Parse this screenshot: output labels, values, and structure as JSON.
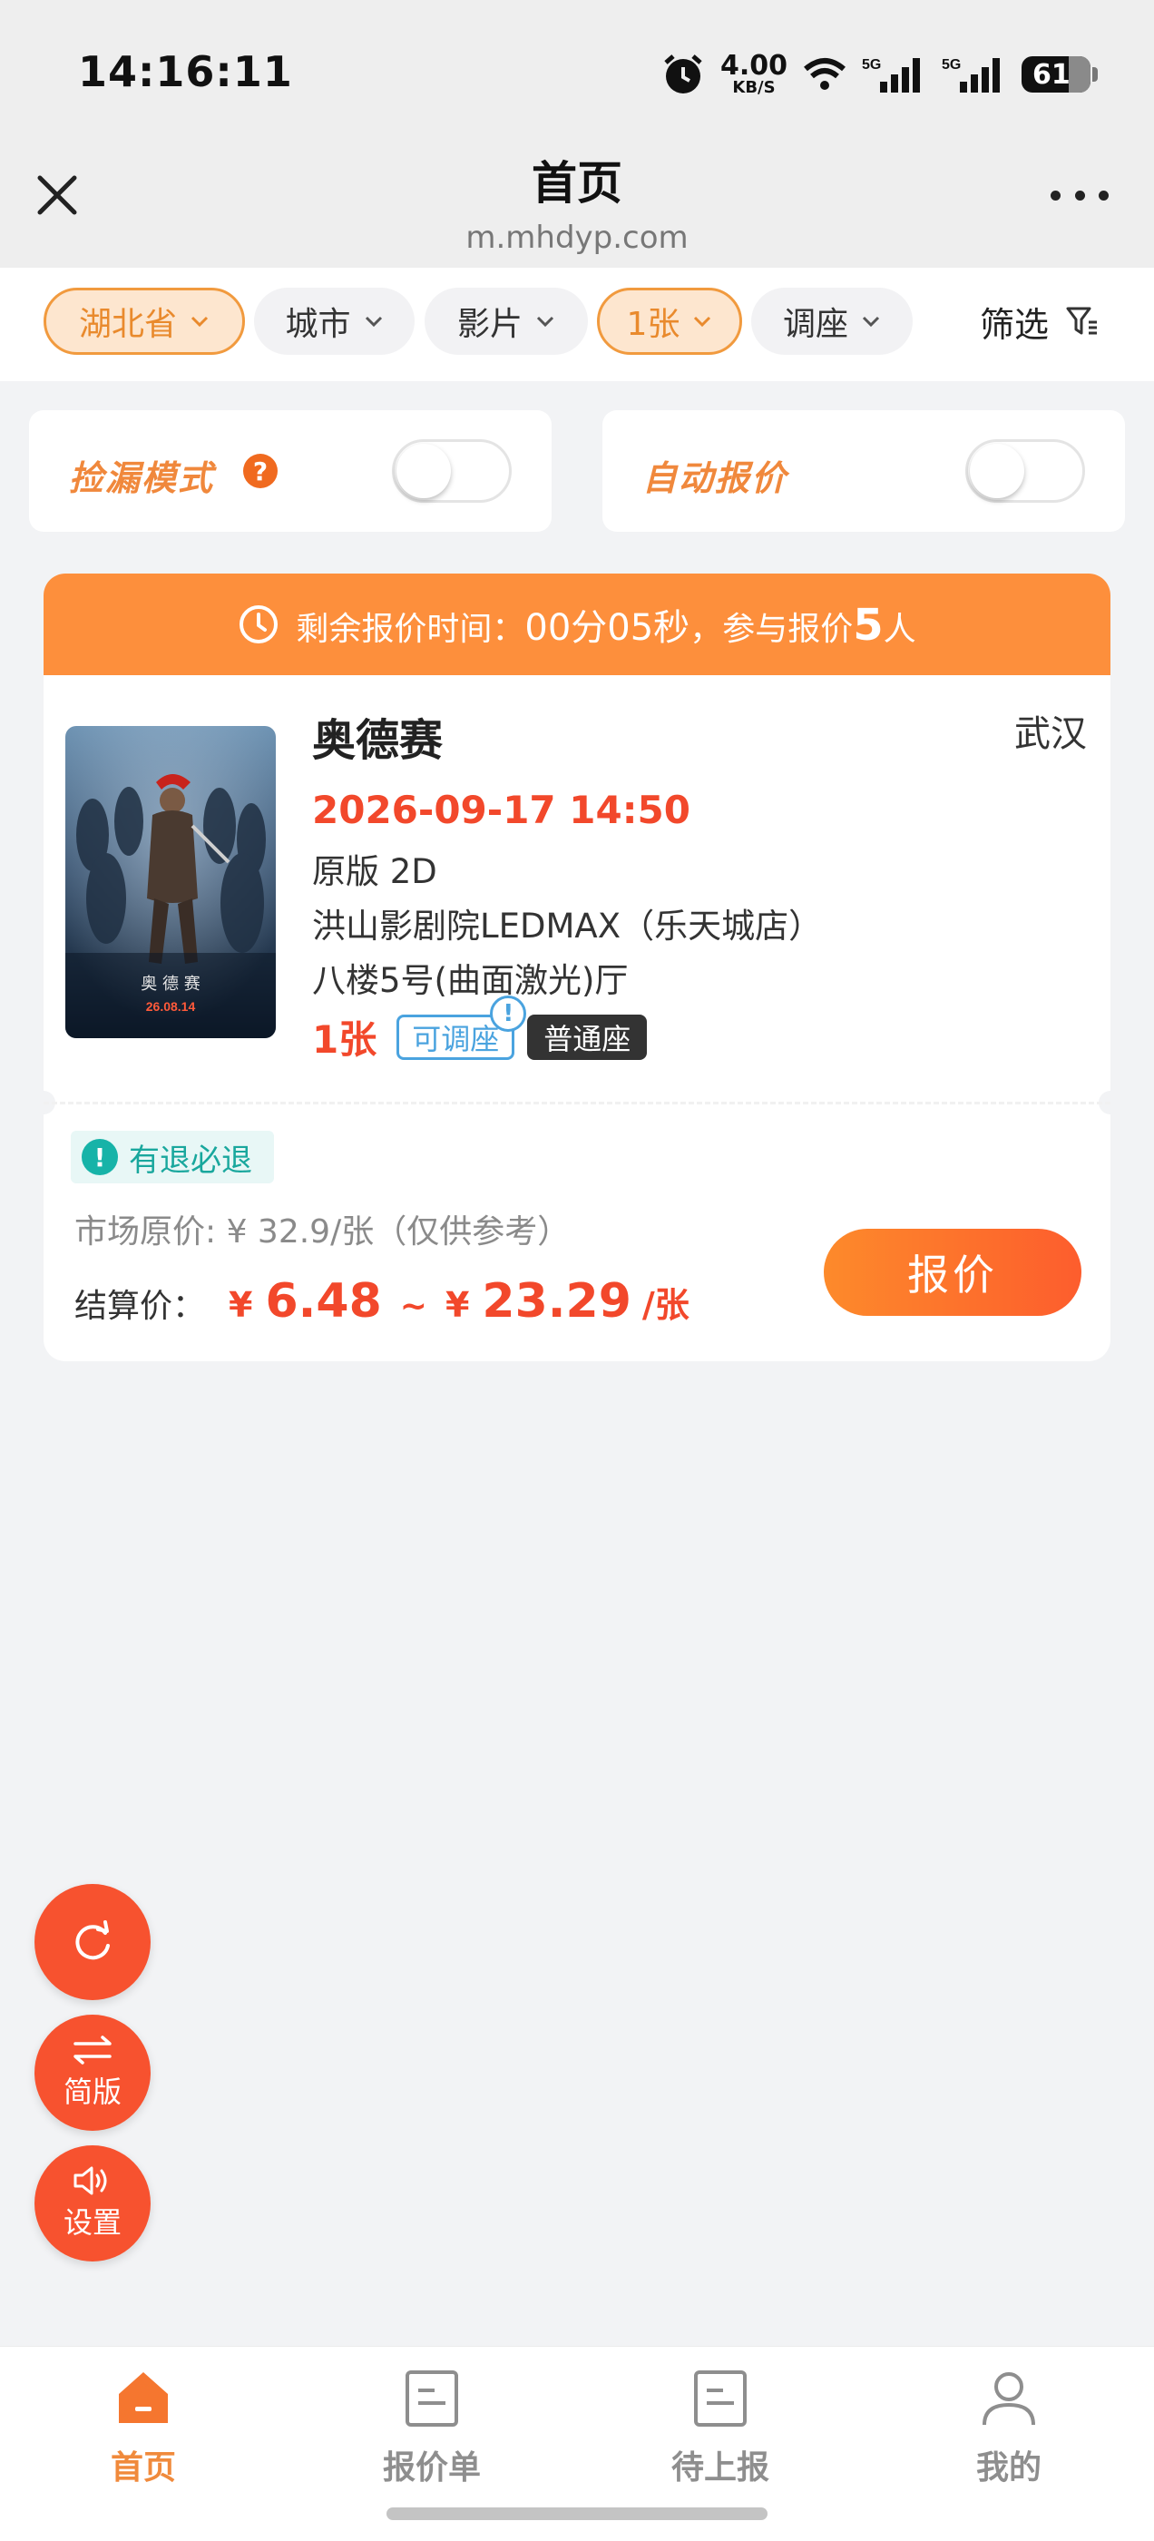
{
  "status_bar": {
    "time": "14:16:11",
    "net_speed_value": "4.00",
    "net_speed_unit": "KB/S",
    "signal_1": "5G",
    "signal_2": "5G",
    "battery": "61"
  },
  "header": {
    "title": "首页",
    "url": "m.mhdyp.com"
  },
  "filters": {
    "province": "湖北省",
    "city": "城市",
    "movie": "影片",
    "tickets": "1张",
    "seat_adjust": "调座",
    "filter_label": "筛选"
  },
  "toggles": {
    "pickup_mode": {
      "label": "捡漏模式",
      "help": "?",
      "on": false
    },
    "auto_quote": {
      "label": "自动报价",
      "on": false
    }
  },
  "order": {
    "countdown_label": "剩余报价时间：",
    "countdown": "00分05秒",
    "participants_prefix": "，参与报价",
    "participants_count": "5",
    "participants_suffix": "人",
    "movie_title": "奥德赛",
    "city": "武汉",
    "show_time": "2026-09-17 14:50",
    "version": "原版 2D",
    "cinema": "洪山影剧院LEDMAX（乐天城店）",
    "hall": "八楼5号(曲面激光)厅",
    "quantity": "1张",
    "tag_adjustable": "可调座",
    "tag_seat_type": "普通座",
    "refund_label": "有退必退",
    "market_price": "市场原价: ¥ 32.9/张（仅供参考）",
    "settle_label": "结算价：",
    "currency": "¥",
    "price_min": "6.48",
    "range_sep": "~",
    "price_max": "23.29",
    "price_unit": "/张",
    "quote_button": "报价",
    "poster": {
      "line": "奥 德 赛",
      "date": "26.08.14"
    }
  },
  "floating": {
    "refresh": "",
    "simple": "简版",
    "settings": "设置"
  },
  "tabbar": {
    "home": "首页",
    "quotes": "报价单",
    "pending": "待上报",
    "mine": "我的",
    "active": "home"
  },
  "colors": {
    "accent": "#fd8f3c",
    "price_red": "#f2482b",
    "fab_red": "#f7522f"
  }
}
